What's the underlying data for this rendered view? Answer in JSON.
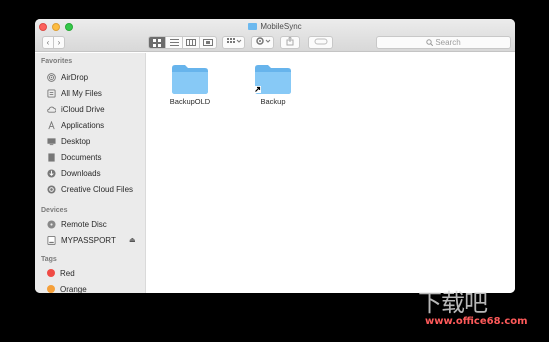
{
  "window": {
    "title": "MobileSync"
  },
  "toolbar": {
    "back_glyph": "‹",
    "forward_glyph": "›",
    "search_placeholder": "Search"
  },
  "sidebar": {
    "favorites_header": "Favorites",
    "favorites": [
      {
        "label": "AirDrop",
        "icon": "airdrop-icon"
      },
      {
        "label": "All My Files",
        "icon": "all-files-icon"
      },
      {
        "label": "iCloud Drive",
        "icon": "cloud-icon"
      },
      {
        "label": "Applications",
        "icon": "applications-icon"
      },
      {
        "label": "Desktop",
        "icon": "desktop-icon"
      },
      {
        "label": "Documents",
        "icon": "documents-icon"
      },
      {
        "label": "Downloads",
        "icon": "downloads-icon"
      },
      {
        "label": "Creative Cloud Files",
        "icon": "creative-cloud-icon"
      }
    ],
    "devices_header": "Devices",
    "devices": [
      {
        "label": "Remote Disc",
        "icon": "disc-icon"
      },
      {
        "label": "MYPASSPORT",
        "icon": "drive-icon"
      }
    ],
    "tags_header": "Tags",
    "tags": [
      {
        "label": "Red",
        "color": "#f04b45"
      },
      {
        "label": "Orange",
        "color": "#f5a03a"
      }
    ]
  },
  "files": [
    {
      "name": "BackupOLD"
    },
    {
      "name": "Backup"
    }
  ],
  "colors": {
    "folder": "#7cc4f4",
    "accent": "#3a8ee6"
  },
  "watermark": {
    "text": "下载吧",
    "url": "www.office68.com"
  }
}
